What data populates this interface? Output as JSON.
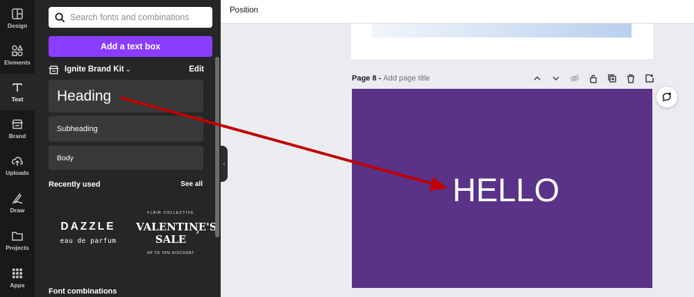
{
  "rail": {
    "items": [
      {
        "label": "Design",
        "icon": "design-icon"
      },
      {
        "label": "Elements",
        "icon": "elements-icon"
      },
      {
        "label": "Text",
        "icon": "text-icon"
      },
      {
        "label": "Brand",
        "icon": "brand-icon"
      },
      {
        "label": "Uploads",
        "icon": "uploads-icon"
      },
      {
        "label": "Draw",
        "icon": "draw-icon"
      },
      {
        "label": "Projects",
        "icon": "projects-icon"
      },
      {
        "label": "Apps",
        "icon": "apps-icon"
      }
    ],
    "active": "Text"
  },
  "panel": {
    "search_placeholder": "Search fonts and combinations",
    "add_text_box": "Add a text box",
    "brand_kit": "Ignite Brand Kit",
    "edit": "Edit",
    "styles": {
      "heading": "Heading",
      "subheading": "Subheading",
      "body": "Body"
    },
    "recently_used": "Recently used",
    "see_all": "See all",
    "templates": [
      {
        "title": "DAZZLE",
        "subtitle": "eau de parfum"
      },
      {
        "top": "FLAIR COLLECTIVE",
        "title_line1": "VALENTINE'S",
        "title_line2": "SALE",
        "bottom": "UP TO 70% DISCOUNT"
      }
    ],
    "font_combinations": "Font combinations"
  },
  "topbar": {
    "position": "Position"
  },
  "canvas": {
    "page_label": "Page 8 - ",
    "page_title_placeholder": "Add page title",
    "page_text": "HELLO",
    "page_color": "#5a3287"
  },
  "colors": {
    "accent": "#8b3dff",
    "annotation_arrow": "#c00000"
  }
}
